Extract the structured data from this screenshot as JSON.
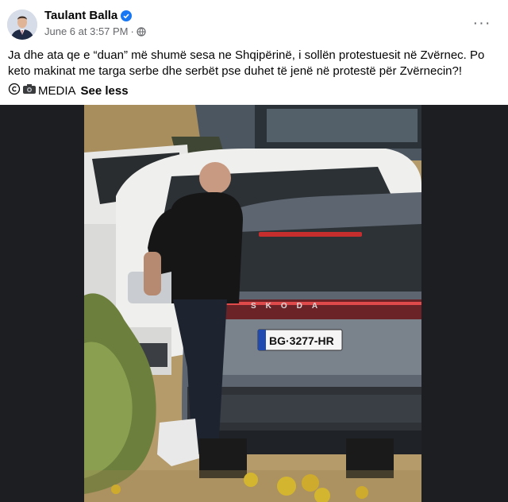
{
  "post": {
    "author": "Taulant Balla",
    "date": "June 6 at 3:57 PM",
    "separator": "·",
    "text": "Ja dhe ata qe e “duan” më shumë sesa ne Shqipërinë, i sollën protestuesit në Zvërnec. Po keto makinat me targa serbe dhe serbët pse duhet të jenë në protestë për Zvërnecin?!",
    "credit_label": "MEDIA",
    "see_less": "See less",
    "more_label": "···"
  },
  "photo": {
    "car_brand": "SKODA",
    "plate": "BG·3277-HR"
  },
  "colors": {
    "verified": "#1877f2",
    "meta": "#65676b",
    "media_bg": "#1c1e21"
  },
  "icons": [
    "verified-badge-icon",
    "globe-icon",
    "copyright-icon",
    "camera-icon",
    "more-icon"
  ]
}
